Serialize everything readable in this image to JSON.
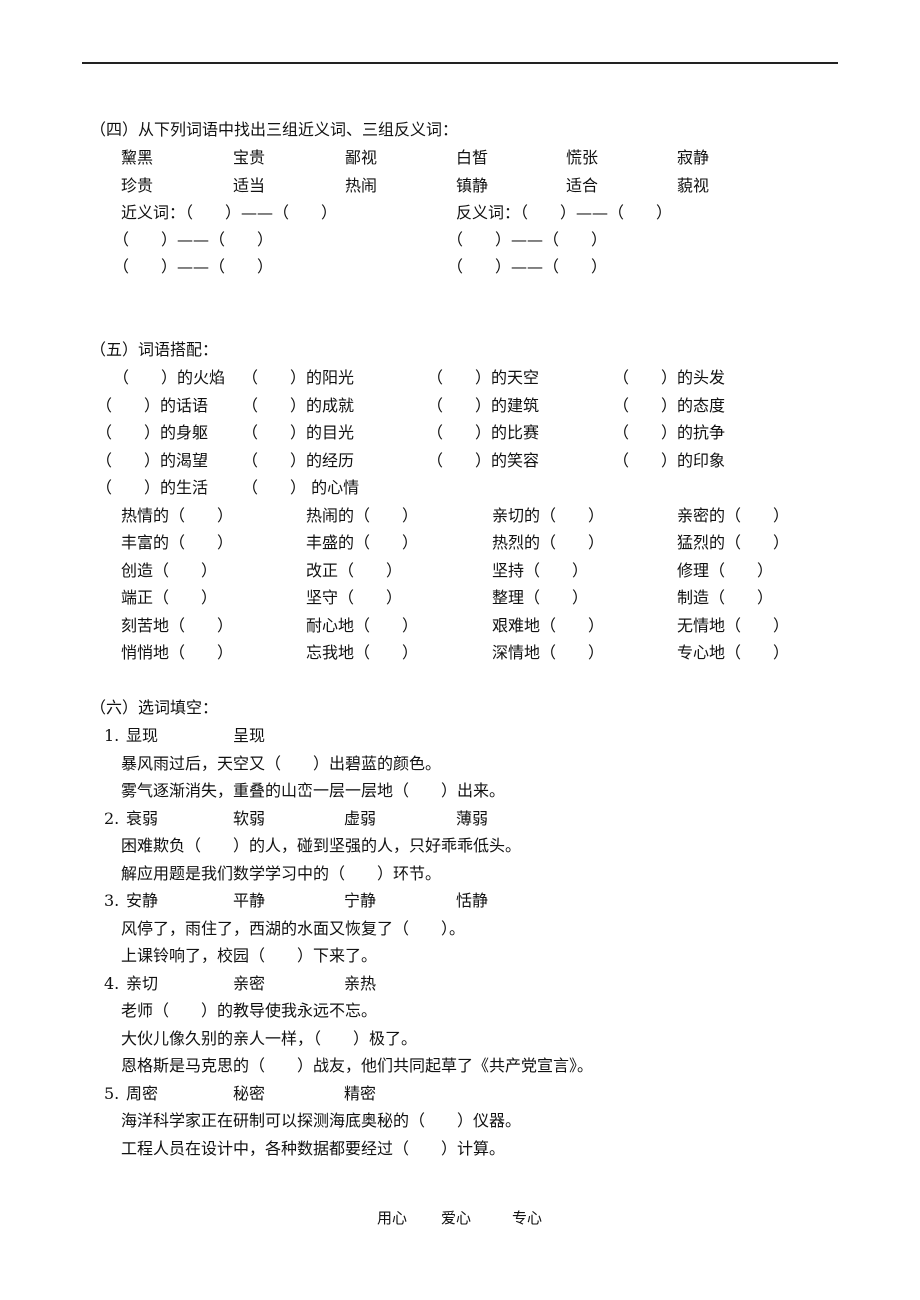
{
  "section4": {
    "heading": "（四）从下列词语中找出三组近义词、三组反义词：",
    "words_row1": [
      "黧黑",
      "宝贵",
      "鄙视",
      "白皙",
      "慌张",
      "寂静"
    ],
    "words_row2": [
      "珍贵",
      "适当",
      "热闹",
      "镇静",
      "适合",
      "藐视"
    ],
    "synonym_label": "近义词：（　　）——（　　）",
    "antonym_label": "反义词：（　　）——（　　）",
    "blank_pair": "（　　）——（　　）"
  },
  "section5": {
    "heading": "（五）词语搭配：",
    "de_rows": [
      [
        "（　　）的火焰",
        "（　　）的阳光",
        "（　　）的天空",
        "（　　）的头发"
      ],
      [
        "（　　）的话语",
        "（　　）的成就",
        "（　　）的建筑",
        "（　　）的态度"
      ],
      [
        "（　　）的身躯",
        "（　　）的目光",
        "（　　）的比赛",
        "（　　）的抗争"
      ],
      [
        "（　　）的渴望",
        "（　　）的经历",
        "（　　）的笑容",
        "（　　）的印象"
      ],
      [
        "（　　）的生活",
        "（　　） 的心情"
      ]
    ],
    "suffix_rows": [
      [
        "热情的（　　）",
        "热闹的（　　）",
        "亲切的（　　）",
        "亲密的（　　）"
      ],
      [
        "丰富的（　　）",
        "丰盛的（　　）",
        "热烈的（　　）",
        "猛烈的（　　）"
      ],
      [
        "创造（　　）",
        "改正（　　）",
        "坚持（　　）",
        "修理（　　）"
      ],
      [
        "端正（　　）",
        "坚守（　　）",
        "整理（　　）",
        "制造（　　）"
      ],
      [
        "刻苦地（　　）",
        "耐心地（　　）",
        "艰难地（　　）",
        "无情地（　　）"
      ],
      [
        "悄悄地（　　）",
        "忘我地（　　）",
        "深情地（　　）",
        "专心地（　　）"
      ]
    ]
  },
  "section6": {
    "heading": "（六）选词填空：",
    "items": [
      {
        "number": "1.",
        "choices": [
          "显现",
          "呈现"
        ],
        "sentences": [
          "暴风雨过后，天空又（　　）出碧蓝的颜色。",
          "雾气逐渐消失，重叠的山峦一层一层地（　　）出来。"
        ]
      },
      {
        "number": "2.",
        "choices": [
          "衰弱",
          "软弱",
          "虚弱",
          "薄弱"
        ],
        "sentences": [
          "困难欺负（　　）的人，碰到坚强的人，只好乖乖低头。",
          "解应用题是我们数学学习中的（　　）环节。"
        ]
      },
      {
        "number": "3.",
        "choices": [
          "安静",
          "平静",
          "宁静",
          "恬静"
        ],
        "sentences": [
          "风停了，雨住了，西湖的水面又恢复了（　　）。",
          "上课铃响了，校园（　　）下来了。"
        ]
      },
      {
        "number": "4.",
        "choices": [
          "亲切",
          "亲密",
          "亲热"
        ],
        "sentences": [
          "老师（　　）的教导使我永远不忘。",
          "大伙儿像久别的亲人一样，（　　）极了。",
          "恩格斯是马克思的（　　）战友，他们共同起草了《共产党宣言》。"
        ]
      },
      {
        "number": "5.",
        "choices": [
          "周密",
          "秘密",
          "精密"
        ],
        "sentences": [
          "海洋科学家正在研制可以探测海底奥秘的（　　）仪器。",
          "工程人员在设计中，各种数据都要经过（　　）计算。"
        ]
      }
    ]
  },
  "footer": [
    "用心",
    "爱心",
    "专心"
  ]
}
